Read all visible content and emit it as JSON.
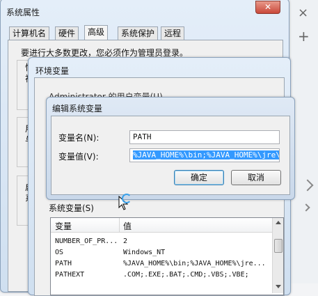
{
  "colors": {
    "accent": "#3399ff",
    "close_red": "#c9483a",
    "pane_bg": "#f0f0f0"
  },
  "sys_props": {
    "title": "系统属性",
    "tabs": [
      "计算机名",
      "硬件",
      "高级",
      "系统保护",
      "远程"
    ],
    "admin_notice": "要进行大多数更改，您必须作为管理员登录。",
    "partial": {
      "p1": "性",
      "p2": "视",
      "p3": "用",
      "p4": "与",
      "p5": "启",
      "p6": "系"
    }
  },
  "env_vars": {
    "title": "环境变量",
    "user_vars_label_partial": "Administrator 的用户变量(U)",
    "system_vars_label": "系统变量(S)",
    "columns": [
      "变量",
      "值"
    ],
    "rows": [
      {
        "name": "NUMBER_OF_PR...",
        "value": "2"
      },
      {
        "name": "OS",
        "value": "Windows_NT"
      },
      {
        "name": "PATH",
        "value": "%JAVA_HOME%\\bin;%JAVA_HOME%\\jre..."
      },
      {
        "name": "PATHEXT",
        "value": ".COM;.EXE;.BAT;.CMD;.VBS;.VBE;"
      }
    ]
  },
  "edit_dialog": {
    "title": "编辑系统变量",
    "name_label": "变量名(N):",
    "name_value": "PATH",
    "value_label": "变量值(V):",
    "value_value": "%JAVA_HOME%\\bin;%JAVA_HOME%\\jre\\bin;",
    "ok": "确定",
    "cancel": "取消"
  },
  "side_icons": {
    "close": "×",
    "add": "+"
  }
}
